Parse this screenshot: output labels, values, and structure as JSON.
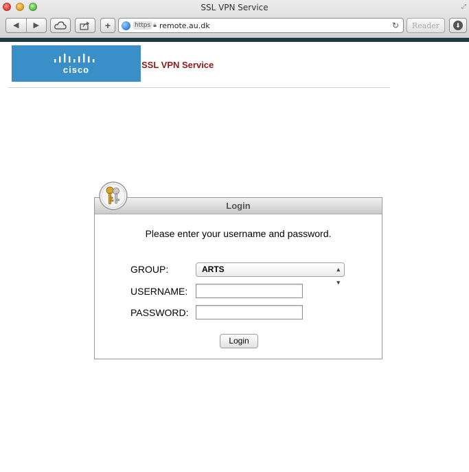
{
  "browser": {
    "window_title": "SSL VPN Service",
    "address": {
      "scheme_badge": "https",
      "host": "remote.au.dk"
    },
    "reader_label": "Reader"
  },
  "header": {
    "logo_text": "cisco",
    "title": "SSL VPN Service"
  },
  "login": {
    "title": "Login",
    "prompt": "Please enter your username and password.",
    "group_label": "GROUP:",
    "group_value": "ARTS",
    "username_label": "USERNAME:",
    "username_value": "",
    "password_label": "PASSWORD:",
    "password_value": "",
    "submit_label": "Login"
  },
  "colors": {
    "cisco_blue": "#3a8fc9",
    "header_title": "#8b1a1a"
  }
}
